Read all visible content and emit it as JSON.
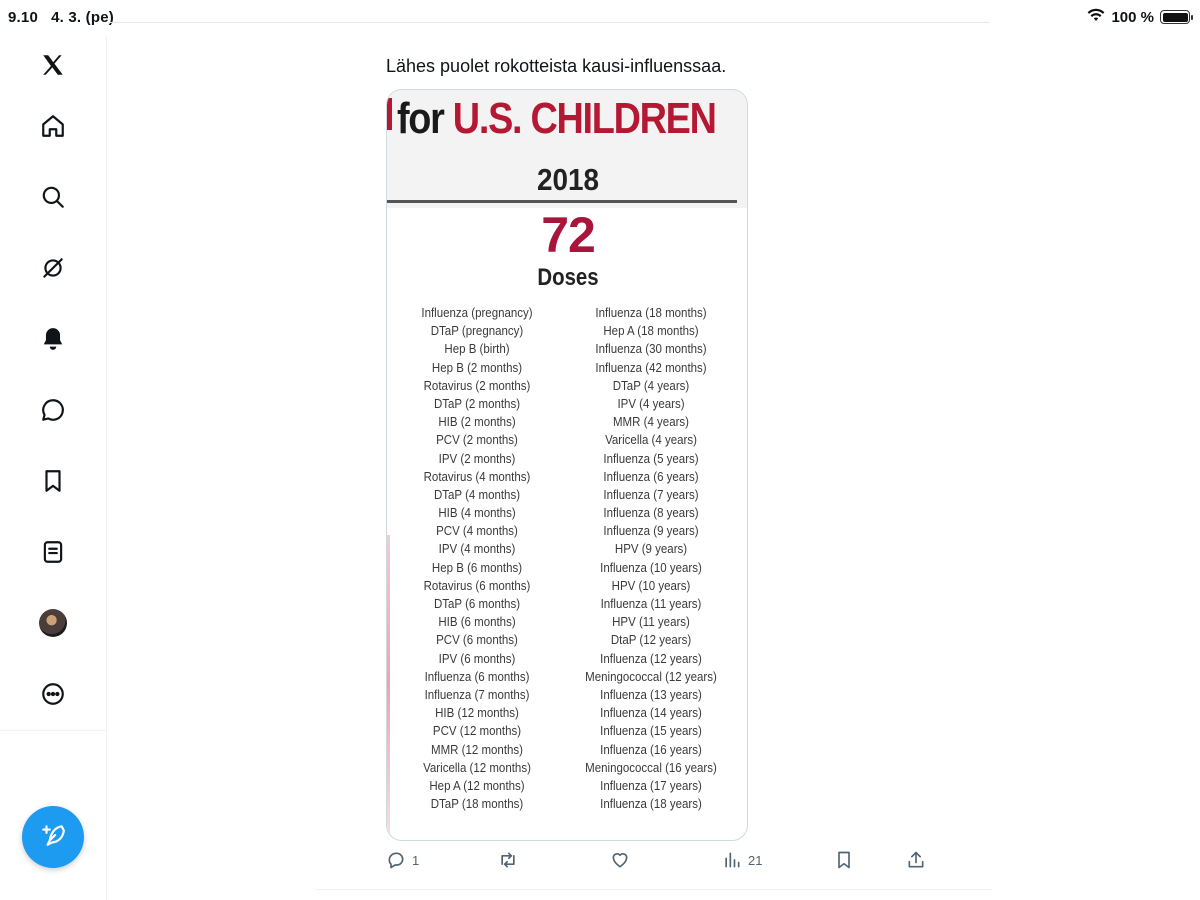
{
  "status_bar": {
    "time": "9.10",
    "date": "4. 3. (pe)",
    "battery": "100 %"
  },
  "sidebar": {
    "items": [
      {
        "name": "x-logo"
      },
      {
        "name": "home"
      },
      {
        "name": "search"
      },
      {
        "name": "grok"
      },
      {
        "name": "notifications"
      },
      {
        "name": "messages"
      },
      {
        "name": "bookmarks"
      },
      {
        "name": "lists"
      },
      {
        "name": "profile"
      },
      {
        "name": "more"
      }
    ],
    "compose_icon": "feather-plus-icon"
  },
  "tweet": {
    "text": "Lähes puolet rokotteista kausi-influenssaa.",
    "image": {
      "headline_black": "for ",
      "headline_red": "U.S. CHILDREN",
      "year": "2018",
      "count": "72",
      "count_label": "Doses",
      "left_column": [
        "Influenza (pregnancy)",
        "DTaP (pregnancy)",
        "Hep B (birth)",
        "Hep B (2 months)",
        "Rotavirus (2 months)",
        "DTaP (2 months)",
        "HIB (2 months)",
        "PCV (2 months)",
        "IPV (2 months)",
        "Rotavirus (4 months)",
        "DTaP (4 months)",
        "HIB (4 months)",
        "PCV (4 months)",
        "IPV (4 months)",
        "Hep B (6 months)",
        "Rotavirus (6 months)",
        "DTaP (6 months)",
        "HIB (6 months)",
        "PCV (6 months)",
        "IPV (6 months)",
        "Influenza (6 months)",
        "Influenza (7 months)",
        "HIB (12 months)",
        "PCV (12 months)",
        "MMR (12 months)",
        "Varicella (12 months)",
        "Hep A (12 months)",
        "DTaP (18 months)"
      ],
      "right_column": [
        "Influenza (18 months)",
        "Hep A (18 months)",
        "Influenza (30 months)",
        "Influenza (42 months)",
        "DTaP (4 years)",
        "IPV (4 years)",
        "MMR (4 years)",
        "Varicella (4 years)",
        "Influenza (5 years)",
        "Influenza (6 years)",
        "Influenza (7 years)",
        "Influenza (8 years)",
        "Influenza (9 years)",
        "HPV (9 years)",
        "Influenza (10 years)",
        "HPV (10 years)",
        "Influenza (11 years)",
        "HPV (11 years)",
        "DtaP (12 years)",
        "Influenza (12 years)",
        "Meningococcal (12 years)",
        "Influenza (13 years)",
        "Influenza (14 years)",
        "Influenza (15 years)",
        "Influenza (16 years)",
        "Meningococcal (16 years)",
        "Influenza (17 years)",
        "Influenza (18 years)"
      ]
    },
    "actions": {
      "reply_count": "1",
      "retweet_count": "",
      "like_count": "",
      "views_count": "21"
    }
  },
  "colors": {
    "accent": "#1d9bf0",
    "headline_red": "#b51833",
    "count_red": "#a8143a"
  }
}
